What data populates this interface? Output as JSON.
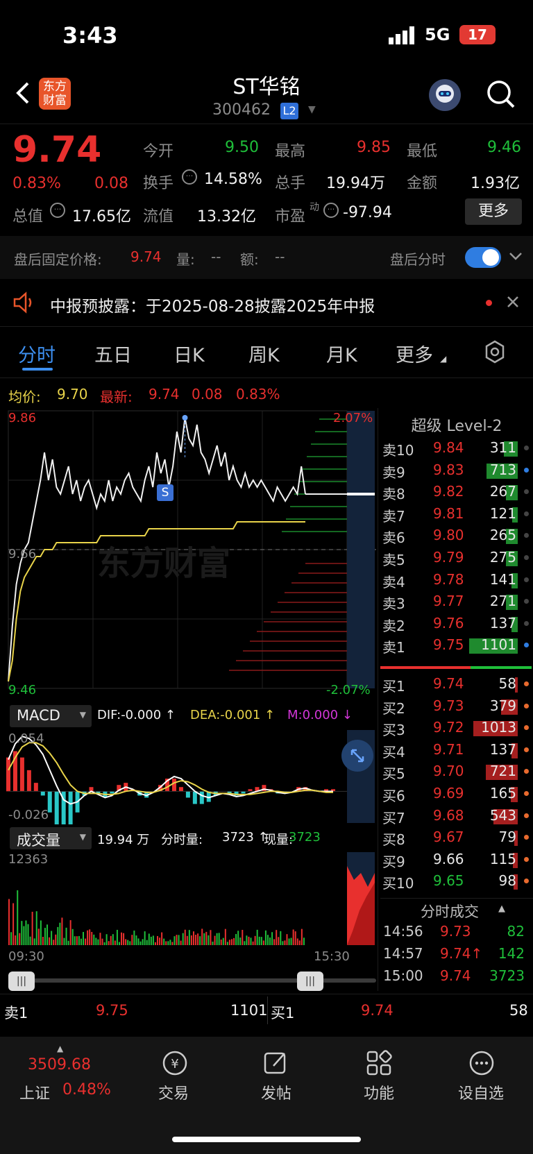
{
  "status": {
    "time": "3:43",
    "network": "5G",
    "battery": "17"
  },
  "header": {
    "title": "ST华铭",
    "code": "300462",
    "level_badge": "L2"
  },
  "quote": {
    "price": "9.74",
    "change_pct": "0.83%",
    "change": "0.08",
    "open_label": "今开",
    "open": "9.50",
    "high_label": "最高",
    "high": "9.85",
    "low_label": "最低",
    "low": "9.46",
    "turnover_label": "换手",
    "turnover": "14.58%",
    "volume_label": "总手",
    "volume": "19.94万",
    "amount_label": "金额",
    "amount": "1.93亿",
    "mktcap_label": "总值",
    "mktcap": "17.65亿",
    "float_label": "流值",
    "float": "13.32亿",
    "pe_label": "市盈",
    "pe_sup": "动",
    "pe": "-97.94",
    "more": "更多"
  },
  "afterhours": {
    "label": "盘后固定价格:",
    "price": "9.74",
    "vol_label": "量:",
    "vol": "--",
    "amt_label": "额:",
    "amt": "--",
    "toggle_label": "盘后分时"
  },
  "notice": {
    "text": "中报预披露：于2025-08-28披露2025年中报"
  },
  "tabs": [
    "分时",
    "五日",
    "日K",
    "周K",
    "月K",
    "更多"
  ],
  "chart_info": {
    "avg_label": "均价:",
    "avg": "9.70",
    "latest_label": "最新:",
    "latest": "9.74",
    "chg": "0.08",
    "pct": "0.83%"
  },
  "chart_data": {
    "type": "line",
    "price_axis": {
      "top": "9.86",
      "mid": "9.66",
      "bottom": "9.46",
      "top_pct": "2.07%",
      "bottom_pct": "-2.07%"
    },
    "time_axis": [
      "09:30",
      "15:30"
    ],
    "watermark": "东方财富",
    "marker": "S",
    "price": [
      9.47,
      9.55,
      9.61,
      9.64,
      9.66,
      9.67,
      9.7,
      9.73,
      9.76,
      9.8,
      9.76,
      9.79,
      9.75,
      9.74,
      9.76,
      9.78,
      9.74,
      9.76,
      9.73,
      9.75,
      9.76,
      9.74,
      9.72,
      9.74,
      9.73,
      9.76,
      9.73,
      9.75,
      9.74,
      9.76,
      9.77,
      9.75,
      9.74,
      9.73,
      9.76,
      9.78,
      9.75,
      9.8,
      9.77,
      9.79,
      9.75,
      9.78,
      9.83,
      9.8,
      9.85,
      9.82,
      9.81,
      9.84,
      9.8,
      9.79,
      9.77,
      9.79,
      9.81,
      9.78,
      9.8,
      9.76,
      9.78,
      9.76,
      9.75,
      9.77,
      9.75,
      9.76,
      9.75,
      9.76,
      9.75,
      9.74,
      9.73,
      9.75,
      9.74,
      9.73,
      9.74,
      9.75,
      9.74,
      9.78,
      9.74
    ],
    "avg": [
      9.47,
      9.5,
      9.56,
      9.6,
      9.62,
      9.63,
      9.64,
      9.65,
      9.65,
      9.66,
      9.66,
      9.66,
      9.67,
      9.67,
      9.67,
      9.67,
      9.67,
      9.67,
      9.67,
      9.67,
      9.67,
      9.67,
      9.67,
      9.68,
      9.68,
      9.68,
      9.68,
      9.68,
      9.68,
      9.68,
      9.68,
      9.68,
      9.68,
      9.68,
      9.68,
      9.69,
      9.69,
      9.69,
      9.69,
      9.69,
      9.69,
      9.69,
      9.69,
      9.69,
      9.69,
      9.69,
      9.69,
      9.69,
      9.69,
      9.69,
      9.69,
      9.69,
      9.69,
      9.69,
      9.69,
      9.69,
      9.69,
      9.7,
      9.7,
      9.7,
      9.7,
      9.7,
      9.7,
      9.7,
      9.7,
      9.7,
      9.7,
      9.7,
      9.7,
      9.7,
      9.7,
      9.7,
      9.7,
      9.7,
      9.7
    ],
    "ymin": 9.46,
    "ymax": 9.86
  },
  "macd": {
    "label": "MACD",
    "dif": "DIF:-0.000 ↑",
    "dea": "DEA:-0.001 ↑",
    "m": "M:0.000 ↓",
    "top": "0.054",
    "bottom": "-0.026",
    "dif_series": [
      0.03,
      0.045,
      0.052,
      0.05,
      0.044,
      0.035,
      0.02,
      0.005,
      -0.008,
      -0.012,
      -0.01,
      -0.004,
      0.0,
      -0.003,
      -0.006,
      -0.004,
      0.001,
      0.004,
      0.002,
      -0.002,
      -0.004,
      -0.001,
      0.004,
      0.01,
      0.014,
      0.012,
      0.006,
      0.0,
      -0.004,
      -0.006,
      -0.004,
      -0.002,
      -0.003,
      -0.005,
      -0.004,
      -0.002,
      0.0,
      0.002,
      0.001,
      -0.001,
      -0.002,
      -0.001,
      0.002,
      0.003,
      0.001,
      0.0,
      0.0,
      0.0
    ],
    "dea_series": [
      0.02,
      0.032,
      0.042,
      0.046,
      0.046,
      0.043,
      0.036,
      0.027,
      0.016,
      0.006,
      0.0,
      -0.002,
      -0.002,
      -0.002,
      -0.003,
      -0.003,
      -0.002,
      0.0,
      0.001,
      0.0,
      -0.001,
      -0.001,
      0.001,
      0.004,
      0.008,
      0.01,
      0.009,
      0.006,
      0.002,
      -0.001,
      -0.002,
      -0.002,
      -0.002,
      -0.003,
      -0.003,
      -0.003,
      -0.002,
      -0.001,
      0.0,
      0.0,
      -0.001,
      -0.001,
      0.0,
      0.001,
      0.001,
      0.0,
      -0.001,
      -0.001
    ]
  },
  "volume": {
    "label": "成交量",
    "total": "19.94 万",
    "split_label": "分时量:",
    "split": "3723 ↑",
    "now_label": "现量:",
    "now": "3723",
    "top": "12363"
  },
  "orderbook": {
    "title": "超级 Level-2",
    "asks": [
      {
        "label": "卖10",
        "price": "9.84",
        "vol": "311"
      },
      {
        "label": "卖9",
        "price": "9.83",
        "vol": "713"
      },
      {
        "label": "卖8",
        "price": "9.82",
        "vol": "267"
      },
      {
        "label": "卖7",
        "price": "9.81",
        "vol": "121"
      },
      {
        "label": "卖6",
        "price": "9.80",
        "vol": "265"
      },
      {
        "label": "卖5",
        "price": "9.79",
        "vol": "275"
      },
      {
        "label": "卖4",
        "price": "9.78",
        "vol": "141"
      },
      {
        "label": "卖3",
        "price": "9.77",
        "vol": "271"
      },
      {
        "label": "卖2",
        "price": "9.76",
        "vol": "137"
      },
      {
        "label": "卖1",
        "price": "9.75",
        "vol": "1101"
      }
    ],
    "bids": [
      {
        "label": "买1",
        "price": "9.74",
        "vol": "58"
      },
      {
        "label": "买2",
        "price": "9.73",
        "vol": "379"
      },
      {
        "label": "买3",
        "price": "9.72",
        "vol": "1013"
      },
      {
        "label": "买4",
        "price": "9.71",
        "vol": "137"
      },
      {
        "label": "买5",
        "price": "9.70",
        "vol": "721"
      },
      {
        "label": "买6",
        "price": "9.69",
        "vol": "165"
      },
      {
        "label": "买7",
        "price": "9.68",
        "vol": "543"
      },
      {
        "label": "买8",
        "price": "9.67",
        "vol": "79"
      },
      {
        "label": "买9",
        "price": "9.66",
        "vol": "115"
      },
      {
        "label": "买10",
        "price": "9.65",
        "vol": "98"
      }
    ]
  },
  "trades": {
    "title": "分时成交",
    "rows": [
      {
        "time": "14:56",
        "price": "9.73",
        "vol": "82"
      },
      {
        "time": "14:57",
        "price": "9.74↑",
        "vol": "142"
      },
      {
        "time": "15:00",
        "price": "9.74",
        "vol": "3723"
      }
    ]
  },
  "bottom_quote": {
    "sell_label": "卖1",
    "sell_price": "9.75",
    "sell_vol": "1101",
    "buy_label": "买1",
    "buy_price": "9.74",
    "buy_vol": "58"
  },
  "index": {
    "value": "3509.68",
    "name": "上证",
    "pct": "0.48%"
  },
  "nav": [
    "交易",
    "发帖",
    "功能",
    "设自选"
  ],
  "colors": {
    "up": "#e8302e",
    "down": "#1fbf3a",
    "avg_line": "#e9d44a",
    "accent": "#2f7de1"
  }
}
